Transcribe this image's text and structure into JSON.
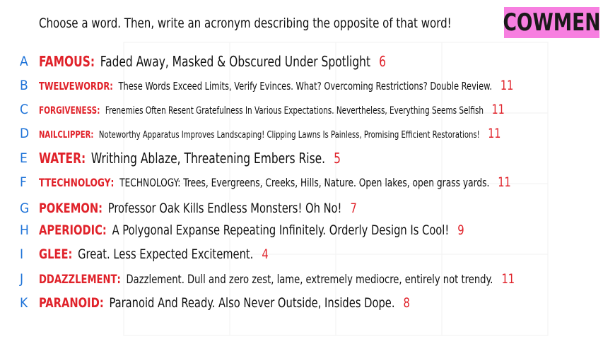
{
  "prompt": "Choose a word. Then, write an acronym describing the opposite of that word!",
  "logo": "COWMEN",
  "colors": {
    "letter": "#1e73d8",
    "word": "#e0222a",
    "logo_bg": "#f77fe0"
  },
  "entries": [
    {
      "letter": "A",
      "word": "FAMOUS",
      "acronym": "Faded Away, Masked & Obscured Under Spotlight",
      "count": "6"
    },
    {
      "letter": "B",
      "word": "TWELVEWORDR",
      "acronym": "These Words Exceed Limits, Verify Evinces. What? Overcoming Restrictions? Double Review.",
      "count": "11"
    },
    {
      "letter": "C",
      "word": "FORGIVENESS",
      "acronym": "Frenemies Often Resent Gratefulness In Various Expectations. Nevertheless, Everything Seems Selfish",
      "count": "11"
    },
    {
      "letter": "D",
      "word": "NAILCLIPPER",
      "acronym": "Noteworthy Apparatus Improves Landscaping! Clipping Lawns Is Painless, Promising Efficient Restorations!",
      "count": "11"
    },
    {
      "letter": "E",
      "word": "WATER",
      "acronym": "Writhing Ablaze, Threatening Embers Rise.",
      "count": "5"
    },
    {
      "letter": "F",
      "word": "TTECHNOLOGY",
      "acronym": "TECHNOLOGY: Trees, Evergreens, Creeks, Hills, Nature. Open lakes, open grass yards.",
      "count": "11"
    },
    {
      "letter": "G",
      "word": "POKEMON",
      "acronym": "Professor Oak Kills Endless Monsters! Oh No!",
      "count": "7"
    },
    {
      "letter": "H",
      "word": "APERIODIC",
      "acronym": "A Polygonal Expanse Repeating Infinitely. Orderly Design Is Cool!",
      "count": "9"
    },
    {
      "letter": "I",
      "word": "GLEE",
      "acronym": "Great. Less Expected Excitement.",
      "count": "4"
    },
    {
      "letter": "J",
      "word": "DDAZZLEMENT",
      "acronym": "Dazzlement. Dull and zero zest, lame, extremely mediocre, entirely not trendy.",
      "count": "11"
    },
    {
      "letter": "K",
      "word": "PARANOID",
      "acronym": "Paranoid And Ready. Also Never Outside, Insides Dope.",
      "count": "8"
    }
  ]
}
